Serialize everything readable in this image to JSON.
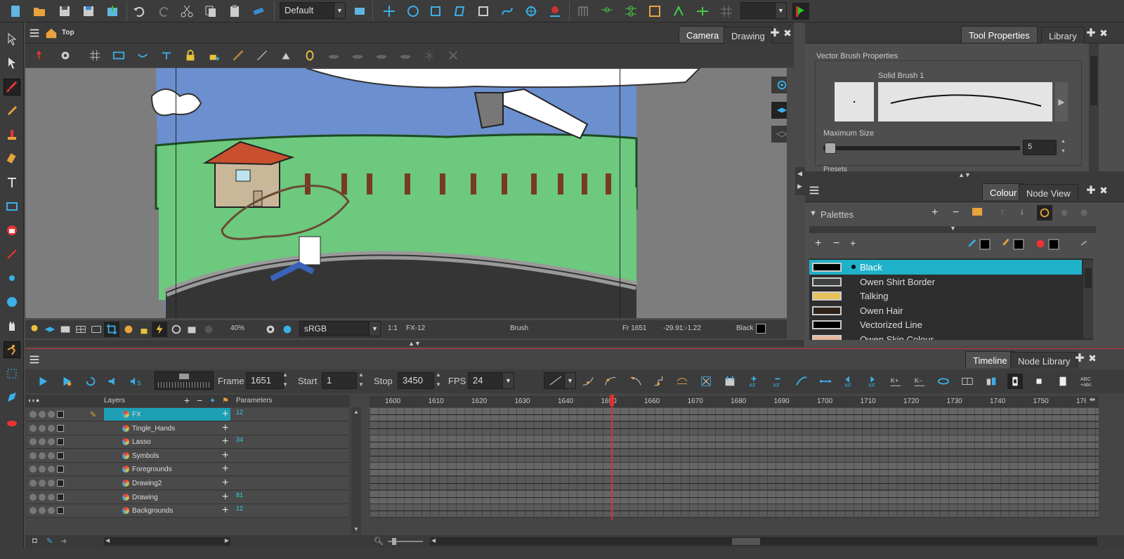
{
  "toolbar": {
    "workspace": "Default"
  },
  "view": {
    "breadcrumb": "Top",
    "tabs": [
      "Camera",
      "Drawing"
    ],
    "zoom": "40%",
    "colour_space": "sRGB",
    "ratio": "1:1",
    "drawing_name": "FX-12",
    "tool": "Brush",
    "frame": "Fr 1651",
    "coords": "-29.91:-1.22",
    "current_colour": "Black"
  },
  "tool_properties": {
    "tabs": [
      "Tool Properties",
      "Library"
    ],
    "title": "Vector Brush Properties",
    "brush_name": "Solid Brush 1",
    "max_size_label": "Maximum Size",
    "max_size_value": "5",
    "presets_label": "Presets"
  },
  "colour": {
    "tabs": [
      "Colour",
      "Node View"
    ],
    "palettes_label": "Palettes",
    "swatches": [
      {
        "name": "Black",
        "color": "#000000"
      },
      {
        "name": "Owen Shirt Border",
        "color": "#3e4340"
      },
      {
        "name": "Talking",
        "color": "#e8c25a"
      },
      {
        "name": "Owen Hair",
        "color": "#2e2219"
      },
      {
        "name": "Vectorized Line",
        "color": "#000000"
      },
      {
        "name": "Owen Skin Colour",
        "color": "#e9b79c"
      }
    ]
  },
  "timeline": {
    "tabs": [
      "Timeline",
      "Node Library"
    ],
    "frame_label": "Frame",
    "frame_value": "1651",
    "start_label": "Start",
    "start_value": "1",
    "stop_label": "Stop",
    "stop_value": "3450",
    "fps_label": "FPS",
    "fps_value": "24",
    "layers_header": "Layers",
    "params_header": "Parameters",
    "layers": [
      {
        "name": "FX",
        "param": "12"
      },
      {
        "name": "Tingle_Hands",
        "param": ""
      },
      {
        "name": "Lasso",
        "param": "34"
      },
      {
        "name": "Symbols",
        "param": ""
      },
      {
        "name": "Foregrounds",
        "param": ""
      },
      {
        "name": "Drawing2",
        "param": ""
      },
      {
        "name": "Drawing",
        "param": "81"
      },
      {
        "name": "Backgrounds",
        "param": "12"
      }
    ],
    "ruler": [
      "1600",
      "1610",
      "1620",
      "1630",
      "1640",
      "1650",
      "1660",
      "1670",
      "1680",
      "1690",
      "1700",
      "1710",
      "1720",
      "1730",
      "1740",
      "1750",
      "176"
    ],
    "ruler_start": 1600,
    "current_frame": 1651
  },
  "colors": {
    "accent": "#1fb1c8",
    "playhead": "#e03030",
    "sky": "#6b8fcf",
    "grass": "#6cc97e"
  }
}
